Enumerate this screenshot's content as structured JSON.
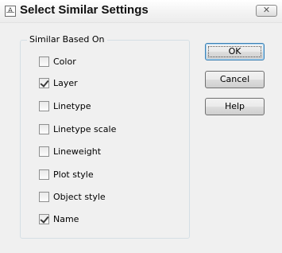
{
  "window": {
    "title": "Select Similar Settings",
    "icon": "app-icon",
    "close_label": "✕"
  },
  "group": {
    "label": "Similar Based On",
    "options": [
      {
        "label": "Color",
        "checked": false
      },
      {
        "label": "Layer",
        "checked": true
      },
      {
        "label": "Linetype",
        "checked": false
      },
      {
        "label": "Linetype scale",
        "checked": false
      },
      {
        "label": "Lineweight",
        "checked": false
      },
      {
        "label": "Plot style",
        "checked": false
      },
      {
        "label": "Object style",
        "checked": false
      },
      {
        "label": "Name",
        "checked": true
      }
    ]
  },
  "buttons": {
    "ok": "OK",
    "cancel": "Cancel",
    "help": "Help"
  }
}
